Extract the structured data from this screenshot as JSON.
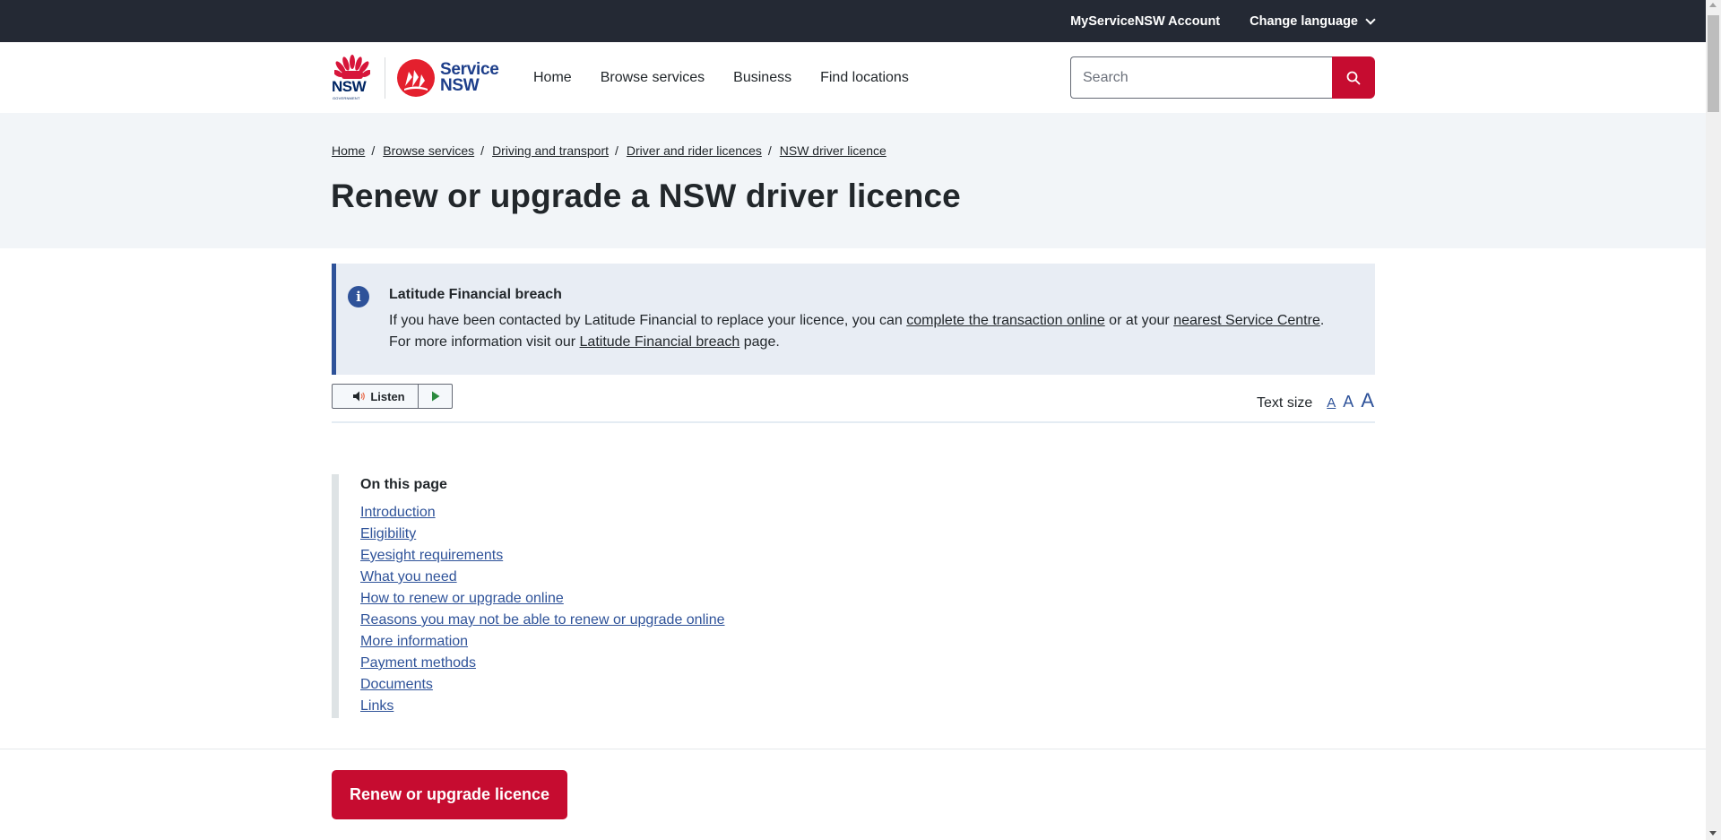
{
  "utility_bar": {
    "account_link": "MyServiceNSW Account",
    "language_link": "Change language"
  },
  "header": {
    "nsw_logo_text": "NSW",
    "nsw_logo_subtext": "GOVERNMENT",
    "service_logo_line1": "Service",
    "service_logo_line2": "NSW",
    "nav": [
      {
        "label": "Home"
      },
      {
        "label": "Browse services"
      },
      {
        "label": "Business"
      },
      {
        "label": "Find locations"
      }
    ],
    "search": {
      "placeholder": "Search",
      "value": ""
    }
  },
  "breadcrumb": [
    {
      "label": "Home"
    },
    {
      "label": "Browse services"
    },
    {
      "label": "Driving and transport"
    },
    {
      "label": "Driver and rider licences"
    },
    {
      "label": "NSW driver licence"
    }
  ],
  "breadcrumb_separator": "/",
  "page_title": "Renew or upgrade a NSW driver licence",
  "alert": {
    "icon": "info-icon",
    "title": "Latitude Financial breach",
    "text_1": "If you have been contacted by Latitude Financial to replace your licence, you can ",
    "link_1": "complete the transaction online",
    "text_2": " or at your ",
    "link_2": "nearest Service Centre",
    "text_3": ". For more information visit our ",
    "link_3": "Latitude Financial breach",
    "text_4": " page."
  },
  "listen": {
    "label": "Listen",
    "icons": [
      "speaker-icon",
      "play-icon"
    ]
  },
  "text_size": {
    "label": "Text size",
    "options": [
      "A",
      "A",
      "A"
    ],
    "selected": 0
  },
  "on_this_page": {
    "title": "On this page",
    "links": [
      "Introduction",
      "Eligibility",
      "Eyesight requirements",
      "What you need",
      "How to renew or upgrade online",
      "Reasons you may not be able to renew or upgrade online",
      "More information",
      "Payment methods",
      "Documents",
      "Links"
    ]
  },
  "cta_button": "Renew or upgrade licence",
  "colors": {
    "brand_red": "#c60c30",
    "brand_blue": "#2e5299",
    "dark_bar": "#242934",
    "band_bg": "#f2f5f8",
    "alert_bg": "#e8edf4"
  }
}
